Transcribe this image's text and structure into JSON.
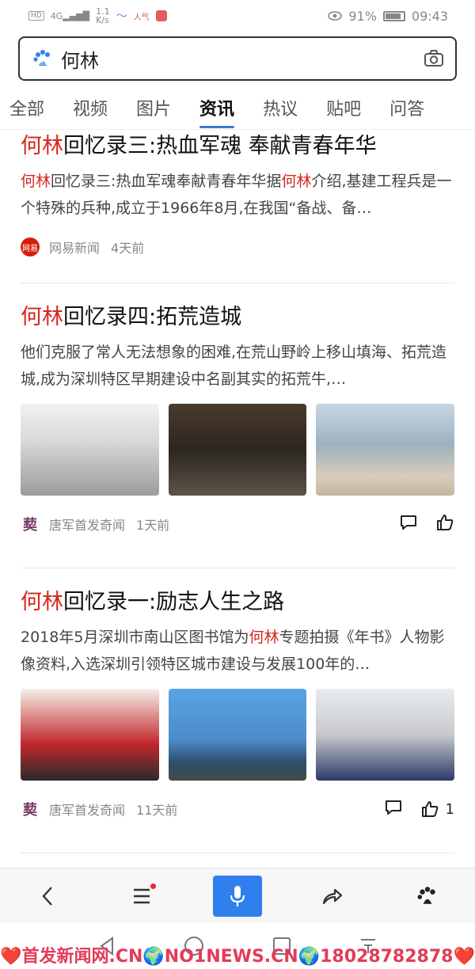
{
  "status_bar": {
    "hd": "HD",
    "signal": "4G",
    "speed": "1.1\nK/s",
    "battery": "91%",
    "time": "09:43"
  },
  "search": {
    "query": "何林"
  },
  "tabs": [
    {
      "label": "全部"
    },
    {
      "label": "视频"
    },
    {
      "label": "图片"
    },
    {
      "label": "资讯"
    },
    {
      "label": "热议"
    },
    {
      "label": "贴吧"
    },
    {
      "label": "问答"
    }
  ],
  "articles": [
    {
      "title_hl": "何林",
      "title_rest": "回忆录三:热血军魂 奉献青春年华",
      "desc_hl1": "何林",
      "desc_mid": "回忆录三:热血军魂奉献青春年华据",
      "desc_hl2": "何林",
      "desc_rest": "介绍,基建工程兵是一个特殊的兵种,成立于1966年8月,在我国“备战、备…",
      "source": "网易新闻",
      "time": "4天前"
    },
    {
      "title_hl": "何林",
      "title_rest": "回忆录四:拓荒造城",
      "desc": "他们克服了常人无法想象的困难,在荒山野岭上移山填海、拓荒造城,成为深圳特区早期建设中名副其实的拓荒牛,…",
      "source": "唐军首发奇闻",
      "time": "1天前"
    },
    {
      "title_hl": "何林",
      "title_rest": "回忆录一:励志人生之路",
      "desc_pre": "2018年5月深圳市南山区图书馆为",
      "desc_hl": "何林",
      "desc_rest": "专题拍摄《年书》人物影像资料,入选深圳引领特区城市建设与发展100年的…",
      "source": "唐军首发奇闻",
      "time": "11天前",
      "likes": "1"
    }
  ],
  "watermark": "❤️首发新闻网.CN🌍NO1NEWS.CN🌍18028782878❤️",
  "colors": {
    "highlight": "#d7261d",
    "accent": "#2f80ed"
  }
}
